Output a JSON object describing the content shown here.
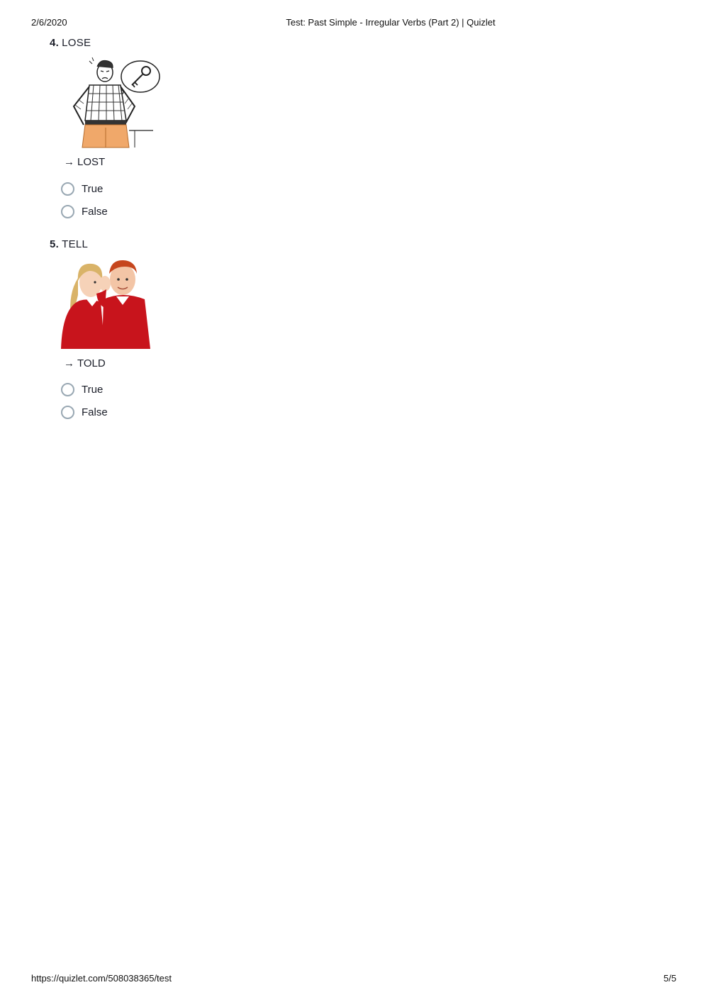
{
  "print_header": {
    "date": "2/6/2020",
    "title": "Test: Past Simple - Irregular Verbs (Part 2) | Quizlet"
  },
  "print_footer": {
    "url": "https://quizlet.com/508038365/test",
    "page": "5/5"
  },
  "questions": [
    {
      "number": "4.",
      "term": "LOSE",
      "image_icon": "lost-key-thinking-man-illustration",
      "answer_arrow": "→",
      "answer": "LOST",
      "options": [
        "True",
        "False"
      ]
    },
    {
      "number": "5.",
      "term": "TELL",
      "image_icon": "children-whispering-photo",
      "answer_arrow": "→",
      "answer": "TOLD",
      "options": [
        "True",
        "False"
      ]
    }
  ],
  "colors": {
    "radio_border": "#98a7b2",
    "text": "#1a1d28",
    "sweater_red": "#c8141c"
  }
}
